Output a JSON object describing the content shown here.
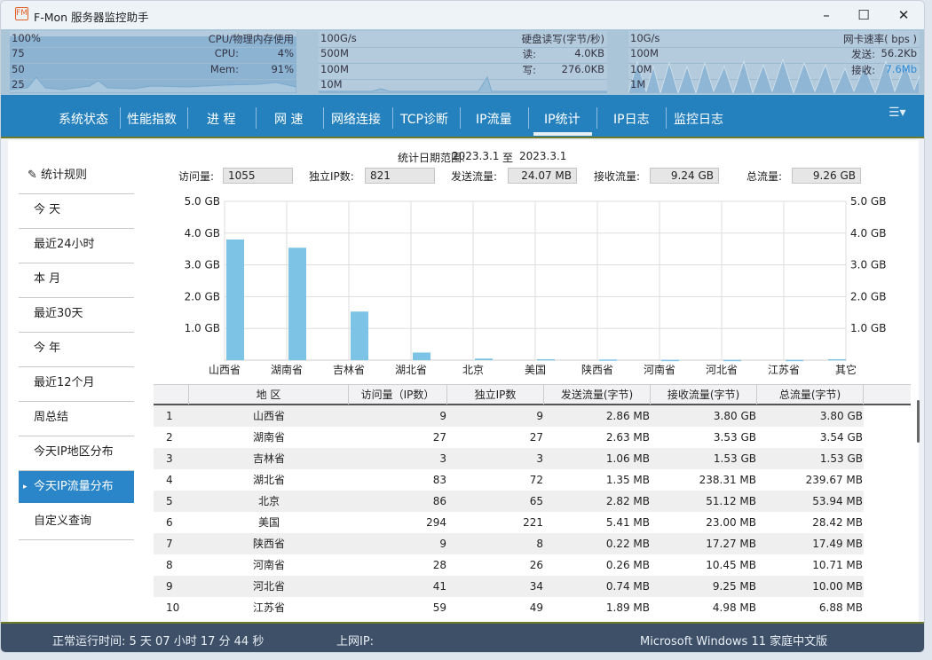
{
  "window": {
    "title": "F-Mon 服务器监控助手",
    "logo": "FM",
    "controls": [
      "minimize-icon",
      "maximize-icon",
      "close-icon"
    ]
  },
  "monitor": {
    "cpu": {
      "title": "CPU/物理内存使用",
      "scale": [
        "100%",
        "75",
        "50",
        "25"
      ],
      "cpu_label": "CPU:",
      "cpu_value": "4%",
      "mem_label": "Mem:",
      "mem_value": "91%",
      "mem_fill_percent": 91
    },
    "disk": {
      "title": "硬盘读写(字节/秒)",
      "scale": [
        "100G/s",
        "500M",
        "100M",
        "10M"
      ],
      "read_label": "读:",
      "read_value": "4.0KB",
      "write_label": "写:",
      "write_value": "276.0KB"
    },
    "net": {
      "title": "网卡速率( bps )",
      "scale": [
        "10G/s",
        "100M",
        "10M",
        "1M"
      ],
      "send_label": "发送:",
      "send_value": "56.2Kb",
      "recv_label": "接收:",
      "recv_value": "7.6Mb",
      "recv_color": "#2a8ad8"
    }
  },
  "nav": {
    "tabs": [
      "系统状态",
      "性能指数",
      "进 程",
      "网 速",
      "网络连接",
      "TCP诊断",
      "IP流量",
      "IP统计",
      "IP日志",
      "监控日志"
    ],
    "active": "IP统计",
    "menu_icon": "hamburger-menu-icon"
  },
  "sidebar": {
    "items": [
      "统计规则",
      "今 天",
      "最近24小时",
      "本 月",
      "最近30天",
      "今 年",
      "最近12个月",
      "周总结",
      "今天IP地区分布",
      "今天IP流量分布",
      "自定义查询"
    ],
    "active": "今天IP流量分布",
    "accent": "#2a86c8"
  },
  "summary": {
    "date_label": "统计日期范围:",
    "date_from": "2023.3.1",
    "date_sep": "至",
    "date_to": "2023.3.1",
    "visits_label": "访问量:",
    "visits": "1055",
    "unique_label": "独立IP数:",
    "unique": "821",
    "sent_label": "发送流量:",
    "sent": "24.07 MB",
    "recv_label": "接收流量:",
    "recv": "9.24 GB",
    "total_label": "总流量:",
    "total": "9.26 GB"
  },
  "chart_data": {
    "type": "bar",
    "categories": [
      "山西省",
      "湖南省",
      "吉林省",
      "湖北省",
      "北京",
      "美国",
      "陕西省",
      "河南省",
      "河北省",
      "江苏省",
      "其它"
    ],
    "values": [
      3.8,
      3.54,
      1.53,
      0.24,
      0.05,
      0.03,
      0.02,
      0.01,
      0.01,
      0.01,
      0.03
    ],
    "unit": "GB",
    "ylim": [
      0,
      5
    ],
    "yticks": [
      "5.0 GB",
      "4.0 GB",
      "3.0 GB",
      "2.0 GB",
      "1.0 GB"
    ],
    "grid": true,
    "bar_color": "#7dc3e6"
  },
  "table": {
    "headers": [
      "",
      "地 区",
      "访问量（IP数）",
      "独立IP数",
      "发送流量(字节)",
      "接收流量(字节)",
      "总流量(字节)"
    ],
    "rows": [
      [
        "1",
        "山西省",
        "9",
        "9",
        "2.86 MB",
        "3.80 GB",
        "3.80 GB"
      ],
      [
        "2",
        "湖南省",
        "27",
        "27",
        "2.63 MB",
        "3.53 GB",
        "3.54 GB"
      ],
      [
        "3",
        "吉林省",
        "3",
        "3",
        "1.06 MB",
        "1.53 GB",
        "1.53 GB"
      ],
      [
        "4",
        "湖北省",
        "83",
        "72",
        "1.35 MB",
        "238.31 MB",
        "239.67 MB"
      ],
      [
        "5",
        "北京",
        "86",
        "65",
        "2.82 MB",
        "51.12 MB",
        "53.94 MB"
      ],
      [
        "6",
        "美国",
        "294",
        "221",
        "5.41 MB",
        "23.00 MB",
        "28.42 MB"
      ],
      [
        "7",
        "陕西省",
        "9",
        "8",
        "0.22 MB",
        "17.27 MB",
        "17.49 MB"
      ],
      [
        "8",
        "河南省",
        "28",
        "26",
        "0.26 MB",
        "10.45 MB",
        "10.71 MB"
      ],
      [
        "9",
        "河北省",
        "41",
        "34",
        "0.74 MB",
        "9.25 MB",
        "10.00 MB"
      ],
      [
        "10",
        "江苏省",
        "59",
        "49",
        "1.89 MB",
        "4.98 MB",
        "6.88 MB"
      ]
    ]
  },
  "status": {
    "uptime": "正常运行时间:  5  天  07 小时 17 分 44 秒",
    "ip_label": "上网IP:",
    "os": "Microsoft Windows 11 家庭中文版"
  }
}
